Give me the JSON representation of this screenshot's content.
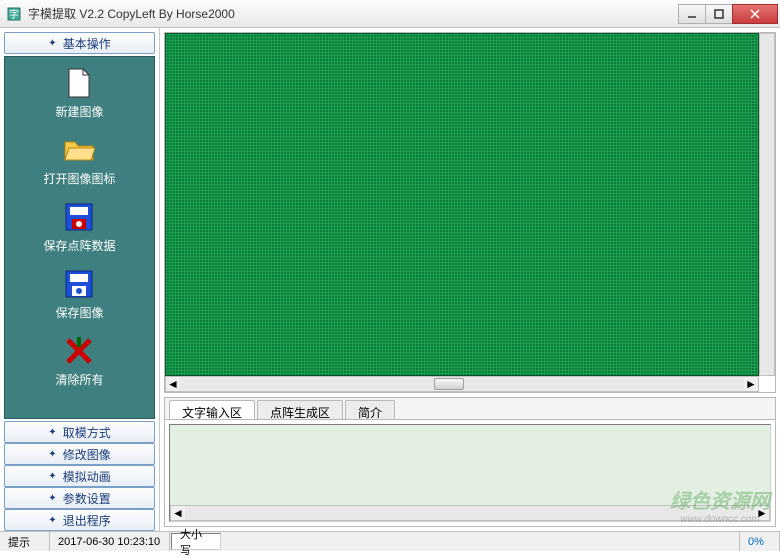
{
  "window": {
    "title": "字模提取 V2.2  CopyLeft By Horse2000"
  },
  "sidebar": {
    "active_group": "基本操作",
    "items": [
      {
        "label": "新建图像",
        "icon": "new-file"
      },
      {
        "label": "打开图像图标",
        "icon": "open-folder"
      },
      {
        "label": "保存点阵数据",
        "icon": "save-data"
      },
      {
        "label": "保存图像",
        "icon": "save-image"
      },
      {
        "label": "清除所有",
        "icon": "clear-all"
      }
    ],
    "groups": [
      {
        "label": "取模方式"
      },
      {
        "label": "修改图像"
      },
      {
        "label": "模拟动画"
      },
      {
        "label": "参数设置"
      },
      {
        "label": "退出程序"
      }
    ]
  },
  "tabs": {
    "items": [
      {
        "label": "文字输入区"
      },
      {
        "label": "点阵生成区"
      },
      {
        "label": "简介"
      }
    ]
  },
  "statusbar": {
    "hint": "提示",
    "datetime": "2017-06-30 10:23:10",
    "caps": "大小写",
    "percent": "0%"
  },
  "watermark": {
    "text": "绿色资源网",
    "url": "www.downcc.com"
  },
  "colors": {
    "canvas_bg": "#0a7a38",
    "sidebar_bg": "#3f7f80"
  }
}
